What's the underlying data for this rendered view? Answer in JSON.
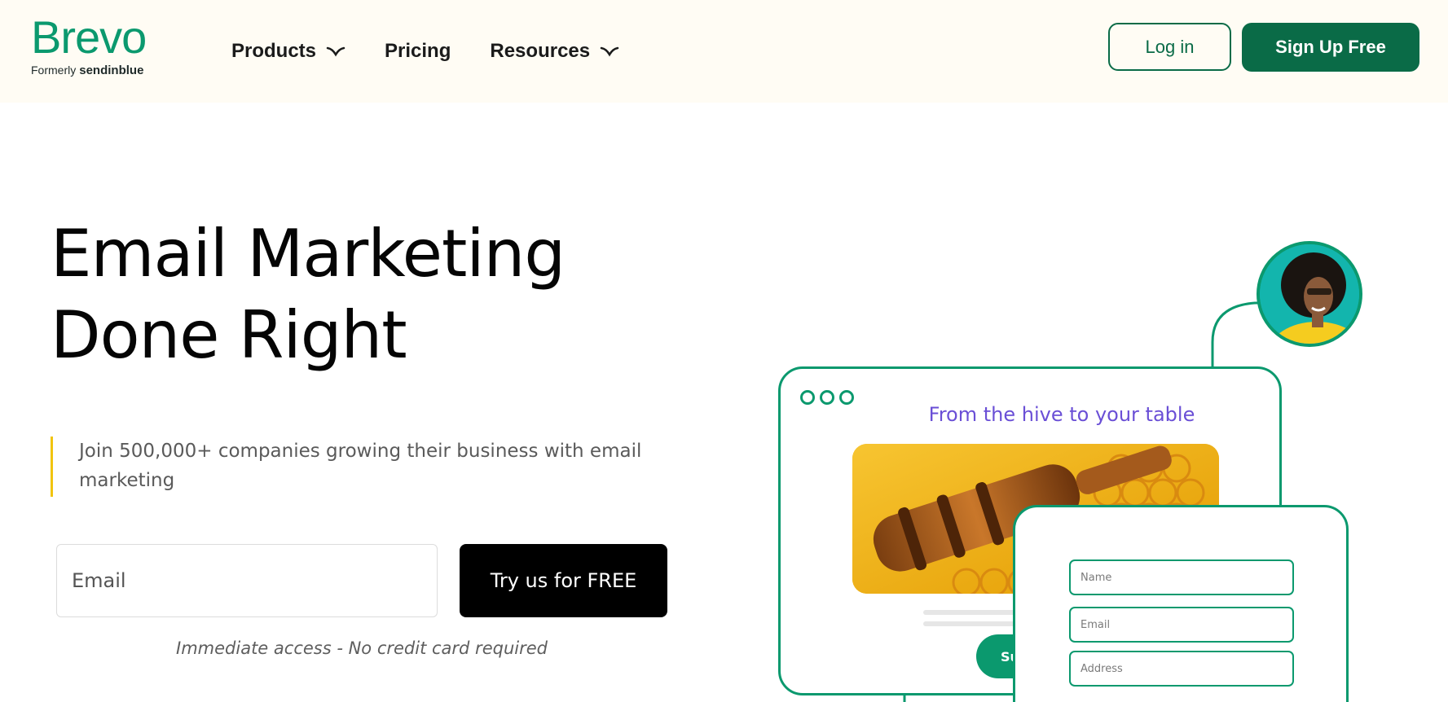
{
  "brand": {
    "name": "Brevo",
    "formerly_label": "Formerly",
    "formerly_name": "sendinblue",
    "color": "#0b996e"
  },
  "nav": {
    "items": [
      {
        "label": "Products",
        "icon": "chevron-down-icon"
      },
      {
        "label": "Pricing"
      },
      {
        "label": "Resources",
        "icon": "chevron-down-icon"
      }
    ]
  },
  "header_actions": {
    "login": "Log in",
    "signup": "Sign Up Free",
    "accent": "#0a6b47"
  },
  "hero": {
    "title_line1": "Email Marketing",
    "title_line2": "Done Right",
    "subtitle": "Join 500,000+ companies growing their business with email marketing",
    "email_placeholder": "Email",
    "cta": "Try us for FREE",
    "note": "Immediate access - No credit card required"
  },
  "illustration": {
    "card_title": "From the hive to your table",
    "subscribe_label": "Su",
    "form_fields": {
      "name_placeholder": "Name",
      "email_placeholder": "Email",
      "address_placeholder": "Address"
    },
    "title_color": "#6a4fd6"
  }
}
